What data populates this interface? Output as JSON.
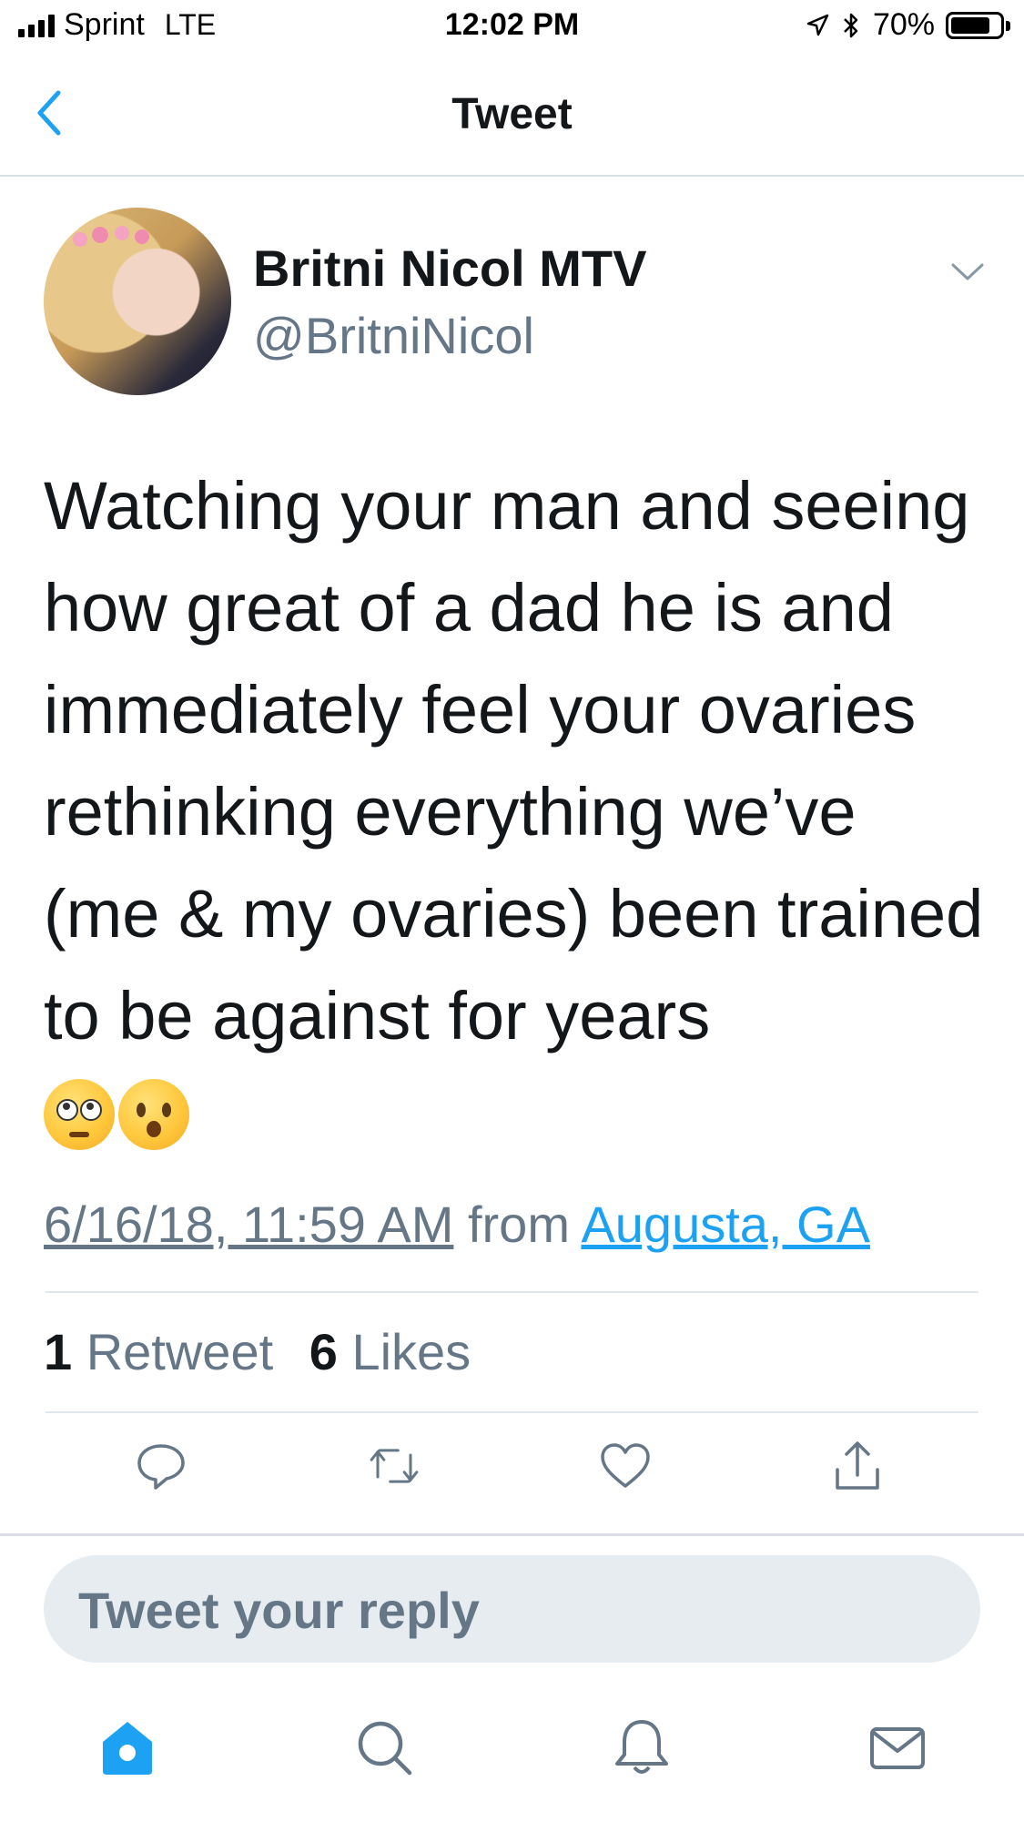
{
  "status_bar": {
    "carrier": "Sprint",
    "network": "LTE",
    "time": "12:02 PM",
    "battery": "70%",
    "icons": [
      "signal-bars-icon",
      "location-arrow-icon",
      "bluetooth-icon",
      "battery-icon"
    ]
  },
  "nav": {
    "title": "Tweet",
    "back_icon": "chevron-left-icon"
  },
  "tweet": {
    "display_name": "Britni Nicol MTV",
    "handle": "@BritniNicol",
    "text": "Watching your man and seeing how great of a dad he is and immediately feel your ovaries rethinking everything we’ve (me & my ovaries) been trained to be against for years",
    "emojis": [
      "face-with-rolling-eyes",
      "hushed-face"
    ],
    "timestamp": "6/16/18, 11:59 AM",
    "from_label": "from",
    "location": "Augusta, GA",
    "retweet_count": "1",
    "retweet_label": "Retweet",
    "like_count": "6",
    "like_label": "Likes"
  },
  "actions": [
    "reply-icon",
    "retweet-icon",
    "like-icon",
    "share-icon"
  ],
  "reply": {
    "placeholder": "Tweet your reply"
  },
  "tab_bar": {
    "items": [
      "home-icon",
      "search-icon",
      "notifications-icon",
      "messages-icon"
    ],
    "active": "home-icon"
  },
  "colors": {
    "accent": "#1da1f2",
    "text_primary": "#14171a",
    "text_secondary": "#657786",
    "divider": "#e1e8ed",
    "reply_bg": "#e6ecf0"
  }
}
